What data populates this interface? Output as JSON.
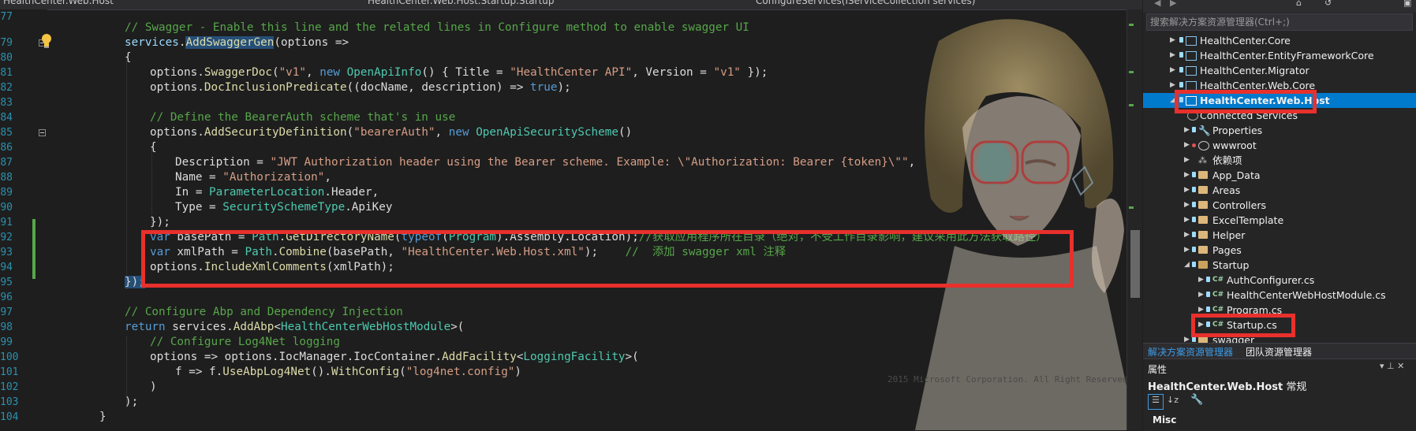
{
  "tab_strip": {
    "project_combo": "HealthCenter.Web.Host",
    "class_combo": "HealthCenter.Web.Host.Startup.Startup",
    "member_combo": "ConfigureServices(IServiceCollection services)"
  },
  "gutter": {
    "line_numbers": [
      "77",
      "79",
      "80",
      "81",
      "82",
      "83",
      "84",
      "85",
      "86",
      "87",
      "88",
      "89",
      "90",
      "91",
      "92",
      "93",
      "94",
      "95",
      "96",
      "97",
      "98",
      "99",
      "100",
      "101",
      "102",
      "103",
      "104"
    ]
  },
  "code": {
    "l77": "// Swagger - Enable this line and the related lines in Configure method to enable swagger UI",
    "l79a": "services",
    "l79b": ".",
    "l79c": "AddSwaggerGen",
    "l79d": "(options =>",
    "l80": "{",
    "l81a": "options.",
    "l81b": "SwaggerDoc",
    "l81c": "(",
    "l81d": "\"v1\"",
    "l81e": ", ",
    "l81f": "new",
    "l81g": " ",
    "l81h": "OpenApiInfo",
    "l81i": "() { Title = ",
    "l81j": "\"HealthCenter API\"",
    "l81k": ", Version = ",
    "l81l": "\"v1\"",
    "l81m": " });",
    "l82a": "options.",
    "l82b": "DocInclusionPredicate",
    "l82c": "((docName, description) => ",
    "l82d": "true",
    "l82e": ");",
    "l84": "// Define the BearerAuth scheme that's in use",
    "l85a": "options.",
    "l85b": "AddSecurityDefinition",
    "l85c": "(",
    "l85d": "\"bearerAuth\"",
    "l85e": ", ",
    "l85f": "new",
    "l85g": " ",
    "l85h": "OpenApiSecurityScheme",
    "l85i": "()",
    "l86": "{",
    "l87a": "Description = ",
    "l87b": "\"JWT Authorization header using the Bearer scheme. Example: \\\"Authorization: Bearer {token}\\\"\"",
    "l87c": ",",
    "l88a": "Name = ",
    "l88b": "\"Authorization\"",
    "l88c": ",",
    "l89a": "In = ",
    "l89b": "ParameterLocation",
    "l89c": ".Header,",
    "l90a": "Type = ",
    "l90b": "SecuritySchemeType",
    "l90c": ".ApiKey",
    "l91": "});",
    "l92a": "var",
    "l92b": " basePath = ",
    "l92c": "Path",
    "l92d": ".",
    "l92e": "GetDirectoryName",
    "l92f": "(",
    "l92g": "typeof",
    "l92h": "(",
    "l92i": "Program",
    "l92j": ").Assembly.Location);",
    "l92k": "//获取应用程序所在目录（绝对，不受工作目录影响，建议采用此方法获取路径）",
    "l93a": "var",
    "l93b": " xmlPath = ",
    "l93c": "Path",
    "l93d": ".",
    "l93e": "Combine",
    "l93f": "(basePath, ",
    "l93g": "\"HealthCenter.Web.Host.xml\"",
    "l93h": ");    ",
    "l93i": "//  添加 swagger xml 注释",
    "l94a": "options.",
    "l94b": "IncludeXmlComments",
    "l94c": "(xmlPath);",
    "l95": "});",
    "l97": "// Configure Abp and Dependency Injection",
    "l98a": "return",
    "l98b": " services.",
    "l98c": "AddAbp",
    "l98d": "<",
    "l98e": "HealthCenterWebHostModule",
    "l98f": ">(",
    "l99": "// Configure Log4Net logging",
    "l100a": "options => options.IocManager.IocContainer.",
    "l100b": "AddFacility",
    "l100c": "<",
    "l100d": "LoggingFacility",
    "l100e": ">(",
    "l101a": "f => f.",
    "l101b": "UseAbpLog4Net",
    "l101c": "().",
    "l101d": "WithConfig",
    "l101e": "(",
    "l101f": "\"log4net.config\"",
    "l101g": ")",
    "l102": ")",
    "l103": ");",
    "l104": "}"
  },
  "watermark": "2015 Microsoft Corporation. All Right Reserved.",
  "solution_explorer": {
    "search_placeholder": "搜索解决方案资源管理器(Ctrl+;)",
    "items": [
      {
        "label": "HealthCenter.Core"
      },
      {
        "label": "HealthCenter.EntityFrameworkCore"
      },
      {
        "label": "HealthCenter.Migrator"
      },
      {
        "label": "HealthCenter.Web.Core"
      },
      {
        "label": "HealthCenter.Web.Host"
      },
      {
        "label": "Connected Services"
      },
      {
        "label": "Properties"
      },
      {
        "label": "wwwroot"
      },
      {
        "label": "依赖项"
      },
      {
        "label": "App_Data"
      },
      {
        "label": "Areas"
      },
      {
        "label": "Controllers"
      },
      {
        "label": "ExcelTemplate"
      },
      {
        "label": "Helper"
      },
      {
        "label": "Pages"
      },
      {
        "label": "Startup"
      },
      {
        "label": "AuthConfigurer.cs"
      },
      {
        "label": "HealthCenterWebHostModule.cs"
      },
      {
        "label": "Program.cs"
      },
      {
        "label": "Startup.cs"
      },
      {
        "label": "swagger"
      }
    ],
    "tabs": [
      "解决方案资源管理器",
      "团队资源管理器"
    ]
  },
  "properties": {
    "header": "属性",
    "object_name": "HealthCenter.Web.Host",
    "object_type": "常规",
    "section": "Misc"
  },
  "colors": {
    "highlight_box": "#e8302c",
    "selection": "#007acc",
    "editor_bg": "#1e1e1e"
  }
}
